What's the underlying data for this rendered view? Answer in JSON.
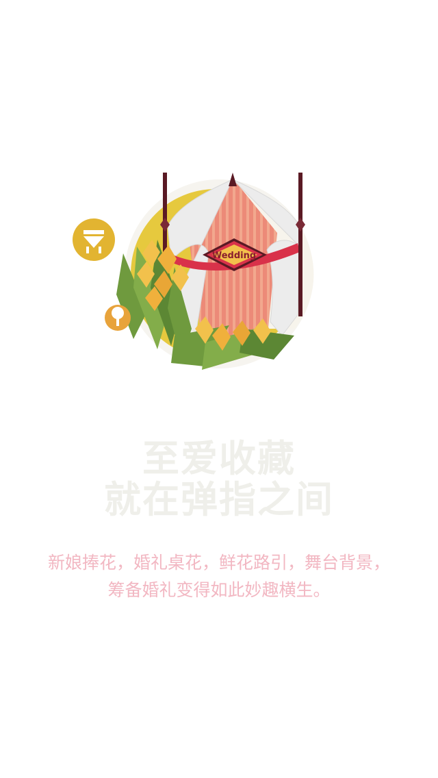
{
  "illustration": {
    "banner_text": "Wedding"
  },
  "headline": {
    "line1": "至爱收藏",
    "line2": "就在弹指之间"
  },
  "description": {
    "line1": "新娘捧花，婚礼桌花，鲜花路引，舞台背景，",
    "line2": "筹备婚礼变得如此妙趣横生。"
  },
  "colors": {
    "background": "#ffffff",
    "headline": "#efefea",
    "description": "#f2b7c2",
    "badge": "#e2b431",
    "tree_badge": "#e8a33b",
    "sun_circle": "#e6c93e",
    "stripe_pink": "#ec8a78",
    "stripe_light": "#f2a88e",
    "banner_red": "#d9324a",
    "pole": "#5a1a24",
    "leaf_green": "#6f9a3e",
    "tulip_yellow": "#f2c14c"
  }
}
